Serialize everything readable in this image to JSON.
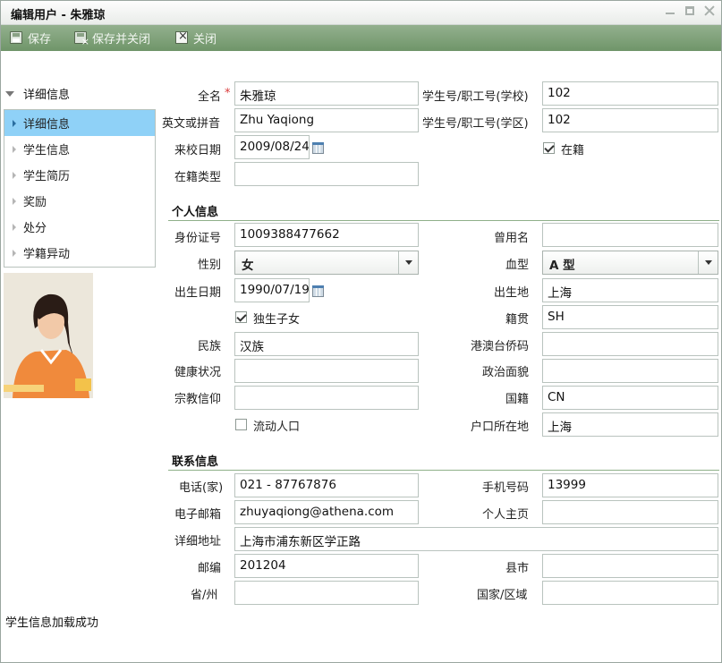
{
  "window": {
    "title": "编辑用户 - 朱雅琼"
  },
  "toolbar": {
    "save": "保存",
    "save_close": "保存并关闭",
    "close": "关闭"
  },
  "nav": {
    "header": "详细信息",
    "items": [
      "详细信息",
      "学生信息",
      "学生简历",
      "奖励",
      "处分",
      "学籍异动"
    ],
    "selected": 0
  },
  "status": "学生信息加载成功",
  "basic": {
    "full_name_label": "全名",
    "full_name": "朱雅琼",
    "english_label": "英文或拼音",
    "english": "Zhu Yaqiong",
    "arrive_label": "来校日期",
    "arrive": "2009/08/24",
    "status_type_label": "在籍类型",
    "status_type": "",
    "sid_school_label": "学生号/职工号(学校)",
    "sid_school": "102",
    "sid_district_label": "学生号/职工号(学区)",
    "sid_district": "102",
    "enrolled_label": "在籍",
    "enrolled": true
  },
  "personal": {
    "section_title": "个人信息",
    "id_label": "身份证号",
    "id": "1009388477662",
    "former_name_label": "曾用名",
    "former_name": "",
    "gender_label": "性别",
    "gender": "女",
    "blood_label": "血型",
    "blood": "A 型",
    "birth_label": "出生日期",
    "birth": "1990/07/19",
    "birthplace_label": "出生地",
    "birthplace": "上海",
    "only_child_label": "独生子女",
    "only_child": true,
    "native_label": "籍贯",
    "native": "SH",
    "ethnic_label": "民族",
    "ethnic": "汉族",
    "overseas_label": "港澳台侨码",
    "overseas": "",
    "health_label": "健康状况",
    "health": "",
    "political_label": "政治面貌",
    "political": "",
    "religion_label": "宗教信仰",
    "religion": "",
    "nationality_label": "国籍",
    "nationality": "CN",
    "floating_label": "流动人口",
    "floating": false,
    "hukou_label": "户口所在地",
    "hukou": "上海"
  },
  "contact": {
    "section_title": "联系信息",
    "phone_label": "电话(家)",
    "phone": "021 - 87767876",
    "mobile_label": "手机号码",
    "mobile": "13999",
    "email_label": "电子邮箱",
    "email": "zhuyaqiong@athena.com",
    "homepage_label": "个人主页",
    "homepage": "",
    "address_label": "详细地址",
    "address": "上海市浦东新区学正路",
    "zip_label": "邮编",
    "zip": "201204",
    "county_label": "县市",
    "county": "",
    "province_label": "省/州",
    "province": "",
    "country_label": "国家/区域",
    "country": ""
  }
}
